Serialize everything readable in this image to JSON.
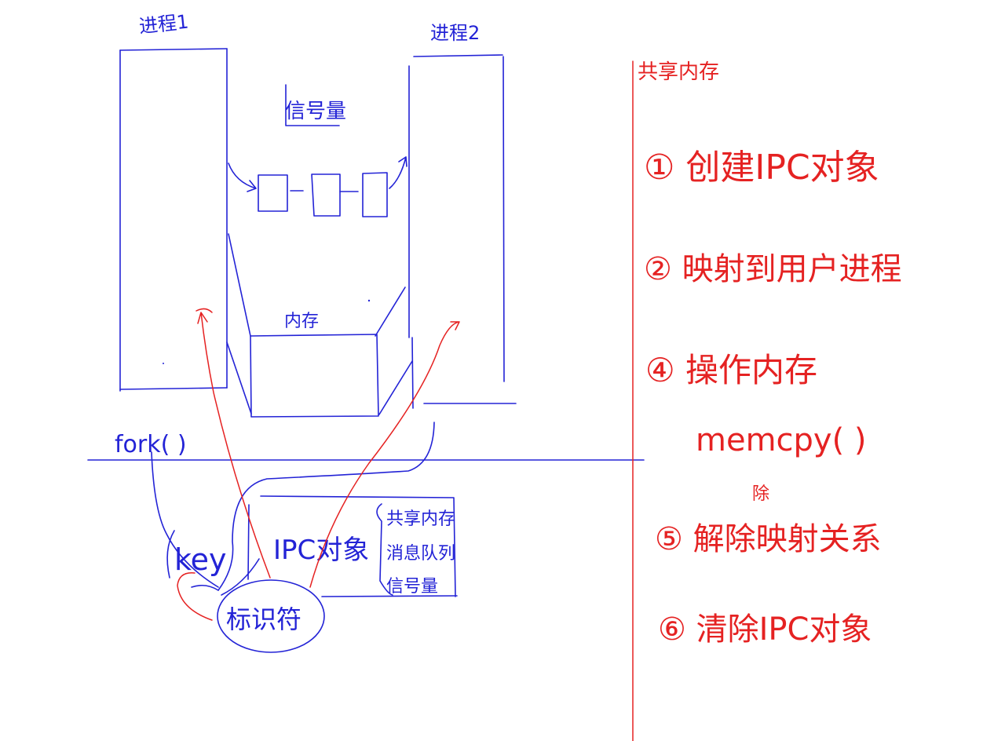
{
  "canvas": {
    "background": "#ffffff",
    "ink_blue": "#2323d6",
    "ink_red": "#e52222"
  },
  "diagram": {
    "process1_label": "进程1",
    "process2_label": "进程2",
    "semaphore_label": "信号量",
    "memory_label": "内存",
    "fork_label": "fork( )",
    "key_label": "key",
    "identifier_label": "标识符",
    "ipc_object_label": "IPC对象",
    "ipc_note_lines": [
      "共享内存",
      "消息队列",
      "信号量"
    ]
  },
  "steps": {
    "heading": "共享内存",
    "items": [
      "① 创建IPC对象",
      "② 映射到用户进程",
      "④ 操作内存",
      "memcpy( )",
      "⑤ 解除映射关系",
      "⑥ 清除IPC对象"
    ],
    "correction_mark": "除"
  }
}
